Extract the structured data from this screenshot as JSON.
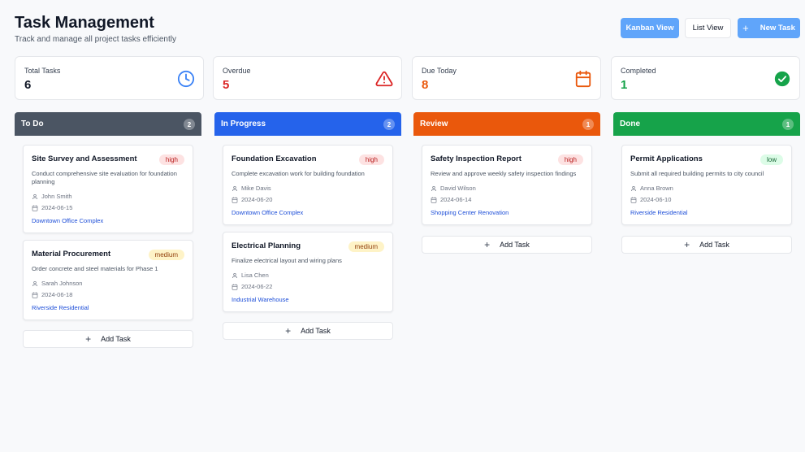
{
  "header": {
    "title": "Task Management",
    "subtitle": "Track and manage all project tasks efficiently"
  },
  "toolbar": {
    "kanban_label": "Kanban View",
    "list_label": "List View",
    "new_label": "New Task"
  },
  "stats": [
    {
      "label": "Total Tasks",
      "value": "6",
      "color": "#111827",
      "icon": "clock-icon"
    },
    {
      "label": "Overdue",
      "value": "5",
      "color": "#dc2626",
      "icon": "alert-triangle-icon"
    },
    {
      "label": "Due Today",
      "value": "8",
      "color": "#ea580c",
      "icon": "calendar-icon"
    },
    {
      "label": "Completed",
      "value": "1",
      "color": "#16a34a",
      "icon": "check-circle-icon"
    }
  ],
  "columns": [
    {
      "title": "To Do",
      "count": "2",
      "color": "#4b5563",
      "add_label": "Add Task",
      "tasks": [
        {
          "title": "Site Survey and Assessment",
          "priority": "high",
          "description": "Conduct comprehensive site evaluation for foundation planning",
          "assignee": "John Smith",
          "date": "2024-06-15",
          "project": "Downtown Office Complex"
        },
        {
          "title": "Material Procurement",
          "priority": "medium",
          "description": "Order concrete and steel materials for Phase 1",
          "assignee": "Sarah Johnson",
          "date": "2024-06-18",
          "project": "Riverside Residential"
        }
      ]
    },
    {
      "title": "In Progress",
      "count": "2",
      "color": "#2563eb",
      "add_label": "Add Task",
      "tasks": [
        {
          "title": "Foundation Excavation",
          "priority": "high",
          "description": "Complete excavation work for building foundation",
          "assignee": "Mike Davis",
          "date": "2024-06-20",
          "project": "Downtown Office Complex"
        },
        {
          "title": "Electrical Planning",
          "priority": "medium",
          "description": "Finalize electrical layout and wiring plans",
          "assignee": "Lisa Chen",
          "date": "2024-06-22",
          "project": "Industrial Warehouse"
        }
      ]
    },
    {
      "title": "Review",
      "count": "1",
      "color": "#ea580c",
      "add_label": "Add Task",
      "tasks": [
        {
          "title": "Safety Inspection Report",
          "priority": "high",
          "description": "Review and approve weekly safety inspection findings",
          "assignee": "David Wilson",
          "date": "2024-06-14",
          "project": "Shopping Center Renovation"
        }
      ]
    },
    {
      "title": "Done",
      "count": "1",
      "color": "#16a34a",
      "add_label": "Add Task",
      "tasks": [
        {
          "title": "Permit Applications",
          "priority": "low",
          "description": "Submit all required building permits to city council",
          "assignee": "Anna Brown",
          "date": "2024-06-10",
          "project": "Riverside Residential"
        }
      ]
    }
  ]
}
